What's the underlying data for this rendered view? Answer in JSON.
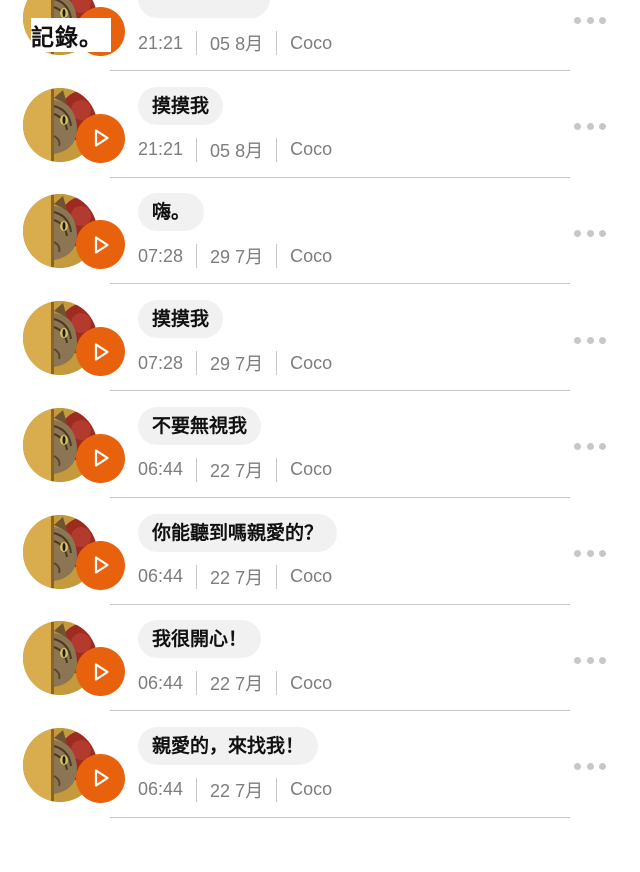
{
  "header": {
    "title": "記錄。"
  },
  "theme": {
    "accent": "#e8620e",
    "bubble_bg": "#f1f1f2",
    "meta_color": "#7d7d80"
  },
  "icons": {
    "play": "play-icon",
    "more": "more-horizontal-icon",
    "avatar": "cat-avatar"
  },
  "messages": [
    {
      "text": "",
      "time": "21:21",
      "date": "05 8月",
      "sender": "Coco"
    },
    {
      "text": "摸摸我",
      "time": "21:21",
      "date": "05 8月",
      "sender": "Coco"
    },
    {
      "text": "嗨。",
      "time": "07:28",
      "date": "29 7月",
      "sender": "Coco"
    },
    {
      "text": "摸摸我",
      "time": "07:28",
      "date": "29 7月",
      "sender": "Coco"
    },
    {
      "text": "不要無視我",
      "time": "06:44",
      "date": "22 7月",
      "sender": "Coco"
    },
    {
      "text": "你能聽到嗎親愛的？",
      "time": "06:44",
      "date": "22 7月",
      "sender": "Coco"
    },
    {
      "text": "我很開心！",
      "time": "06:44",
      "date": "22 7月",
      "sender": "Coco"
    },
    {
      "text": "親愛的，來找我！",
      "time": "06:44",
      "date": "22 7月",
      "sender": "Coco"
    }
  ]
}
